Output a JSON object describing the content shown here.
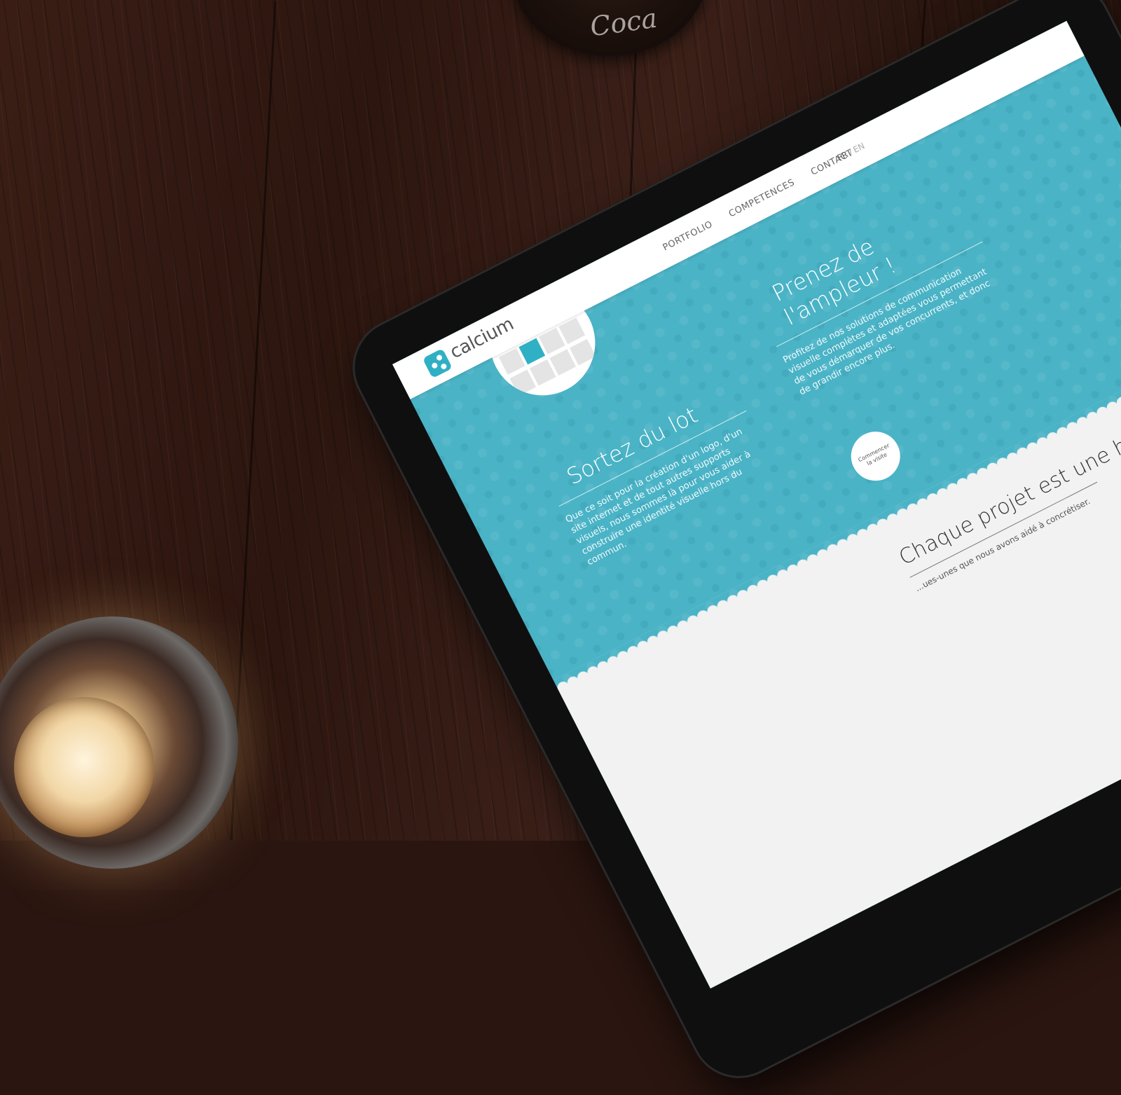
{
  "header": {
    "logo_text": "calcium",
    "nav": [
      "PORTFOLIO",
      "COMPETENCES",
      "CONTACT"
    ],
    "lang_fr": "FR",
    "lang_sep": "/",
    "lang_en": "EN"
  },
  "left_section": {
    "title": "Sortez du lot",
    "body": "Que ce soit pour la création d'un logo, d'un site internet et de tout autres supports visuels, nous sommes là pour vous aider à construire une identité visuelle hors du commun."
  },
  "right_section": {
    "title": "Prenez de l'ampleur !",
    "body": "Profitez de nos solutions de communication visuelle complètes et adaptées vous permettant de vous démarquer de vos concurrents, et donc de grandir encore plus."
  },
  "cta_label": "Commencer la visite",
  "bottom": {
    "title": "Chaque projet est une histoire",
    "subtitle": "...ues-unes que nous avons aidé à concrétiser."
  },
  "mug_text": "Coca",
  "colors": {
    "accent": "#4ab3c6",
    "header_bg": "#ffffff",
    "wood": "#2a1510"
  },
  "icons": [
    "calcium-logo-icon",
    "share-icon",
    "line-chart-icon"
  ]
}
